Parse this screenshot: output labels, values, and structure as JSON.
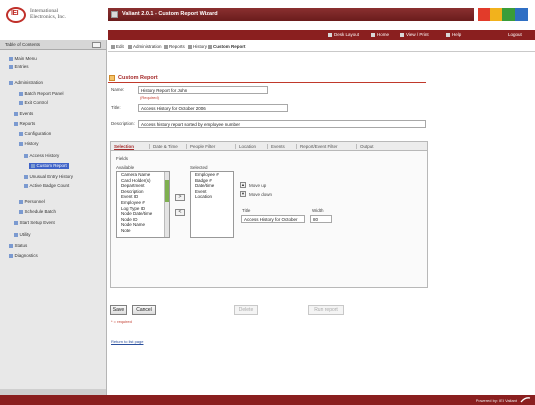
{
  "header": {
    "logo_text": "IEI",
    "company_line1": "International",
    "company_line2": "Electronics, Inc.",
    "app_title": "Valiant 2.0.1 - Custom Report Wizard",
    "brand_colors": [
      "#e23b2a",
      "#f2b21c",
      "#3a9d3a",
      "#2f6fc4"
    ]
  },
  "navbar": {
    "items": [
      {
        "label": "Desk Layout",
        "icon": "monitor-icon"
      },
      {
        "label": "Home",
        "icon": "home-icon"
      },
      {
        "label": "View / Print",
        "icon": "printer-icon"
      },
      {
        "label": "Help",
        "icon": "help-icon"
      },
      {
        "label": "Logout",
        "icon": ""
      }
    ]
  },
  "sidebar": {
    "title": "Table of Contents",
    "items": [
      {
        "label": "Main Menu",
        "indent": 1
      },
      {
        "label": "Entries",
        "indent": 1
      },
      {
        "label": "Administration",
        "indent": 1
      },
      {
        "label": "Batch Report Panel",
        "indent": 3
      },
      {
        "label": "Exit Control",
        "indent": 3
      },
      {
        "label": "Events",
        "indent": 2
      },
      {
        "label": "Reports",
        "indent": 2
      },
      {
        "label": "Configuration",
        "indent": 3
      },
      {
        "label": "History",
        "indent": 3
      },
      {
        "label": "Access History",
        "indent": 4
      },
      {
        "label": "Custom Report",
        "indent": 5,
        "selected": true
      },
      {
        "label": "Unusual Entry History",
        "indent": 4
      },
      {
        "label": "Active Badge Count",
        "indent": 4
      },
      {
        "label": "Personnel",
        "indent": 3
      },
      {
        "label": "Schedule Batch",
        "indent": 3
      },
      {
        "label": "Start Setup Event",
        "indent": 2
      },
      {
        "label": "Utility",
        "indent": 2
      },
      {
        "label": "Status",
        "indent": 1
      },
      {
        "label": "Diagnostics",
        "indent": 1
      }
    ]
  },
  "subtabs": [
    {
      "label": "Edit",
      "active": false
    },
    {
      "label": "Administration",
      "active": false
    },
    {
      "label": "Reports",
      "active": false
    },
    {
      "label": "History",
      "active": false
    },
    {
      "label": "Custom Report",
      "active": true
    }
  ],
  "form": {
    "section_title": "Custom Report",
    "name_label": "Name:",
    "name_value": "History Report for John",
    "name_hint": "(Required)",
    "title_label": "Title:",
    "title_value": "Access History for October 2006",
    "description_label": "Description:",
    "description_value": "Access history report sorted by employee number"
  },
  "tabs": [
    "Selection",
    "Date & Time",
    "People Filter",
    "Location",
    "Events",
    "Report/Event Filter",
    "Output"
  ],
  "selection": {
    "fields_label": "Fields",
    "available_label": "Available",
    "available": [
      "Camera Name",
      "Card Holder(s)",
      "Department",
      "Description",
      "Event ID",
      "Employee #",
      "Log Type ID",
      "Node Date/time",
      "Node ID",
      "Node Name",
      "Note"
    ],
    "selected_label": "Selected",
    "selected": [
      "Employee #",
      "Badge #",
      "Date/time",
      "Event",
      "Location"
    ],
    "move_right": ">",
    "move_left": "<",
    "move_up": "Move up",
    "move_down": "Move down",
    "title_label": "Title",
    "width_label": "Width",
    "column_title_value": "Access History for October",
    "width_value": "80"
  },
  "buttons": {
    "save": "Save",
    "cancel": "Cancel",
    "delete": "Delete",
    "run_report": "Run report"
  },
  "required_note": "* = required",
  "back_link": "Return to list page",
  "footer": {
    "powered_by": "Powered by: IEI Valiant"
  }
}
